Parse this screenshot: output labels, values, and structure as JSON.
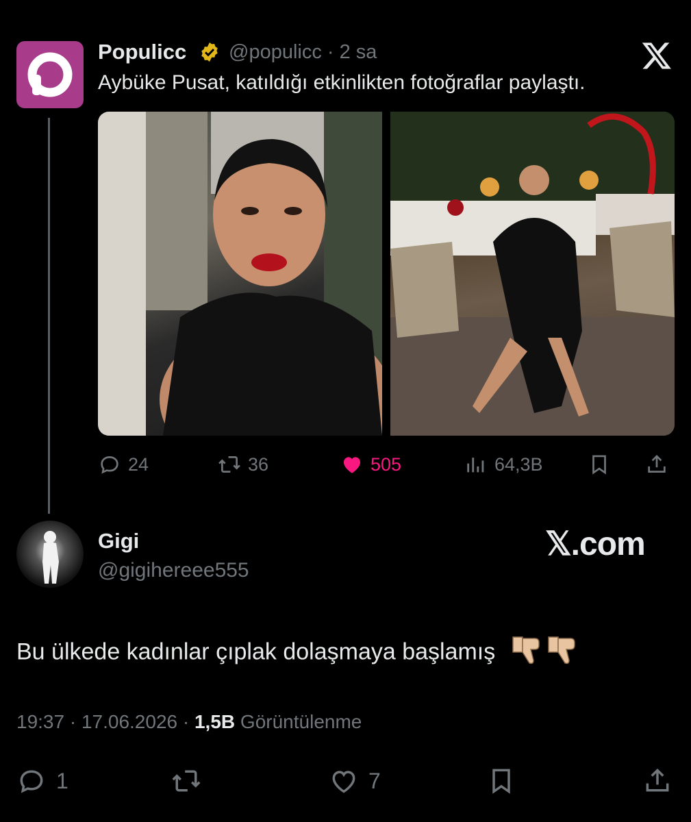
{
  "quoted_tweet": {
    "avatar_letter": "P",
    "name": "Populicc",
    "handle": "@populicc",
    "time": "· 2 sa",
    "text": "Aybüke Pusat, katıldığı etkinlikten fotoğraflar paylaştı.",
    "actions": {
      "replies": "24",
      "retweets": "36",
      "likes": "505",
      "views": "64,3B"
    },
    "brand_icon": "x-logo-icon"
  },
  "reply_tweet": {
    "name": "Gigi",
    "handle": "@gigihereee555",
    "watermark": "𝕏.com",
    "text": "Bu ülkede kadınlar çıplak dolaşmaya başlamış",
    "time": "19:37 · 17.06.2026 ·",
    "views_count": "1,5B",
    "views_label": "Görüntülenme",
    "actions": {
      "replies": "1",
      "likes": "7"
    }
  },
  "colors": {
    "accent_like": "#f91880",
    "verified_gold": "#e2b719",
    "muted": "#71767b",
    "avatar_brand": "#a83b8a"
  }
}
